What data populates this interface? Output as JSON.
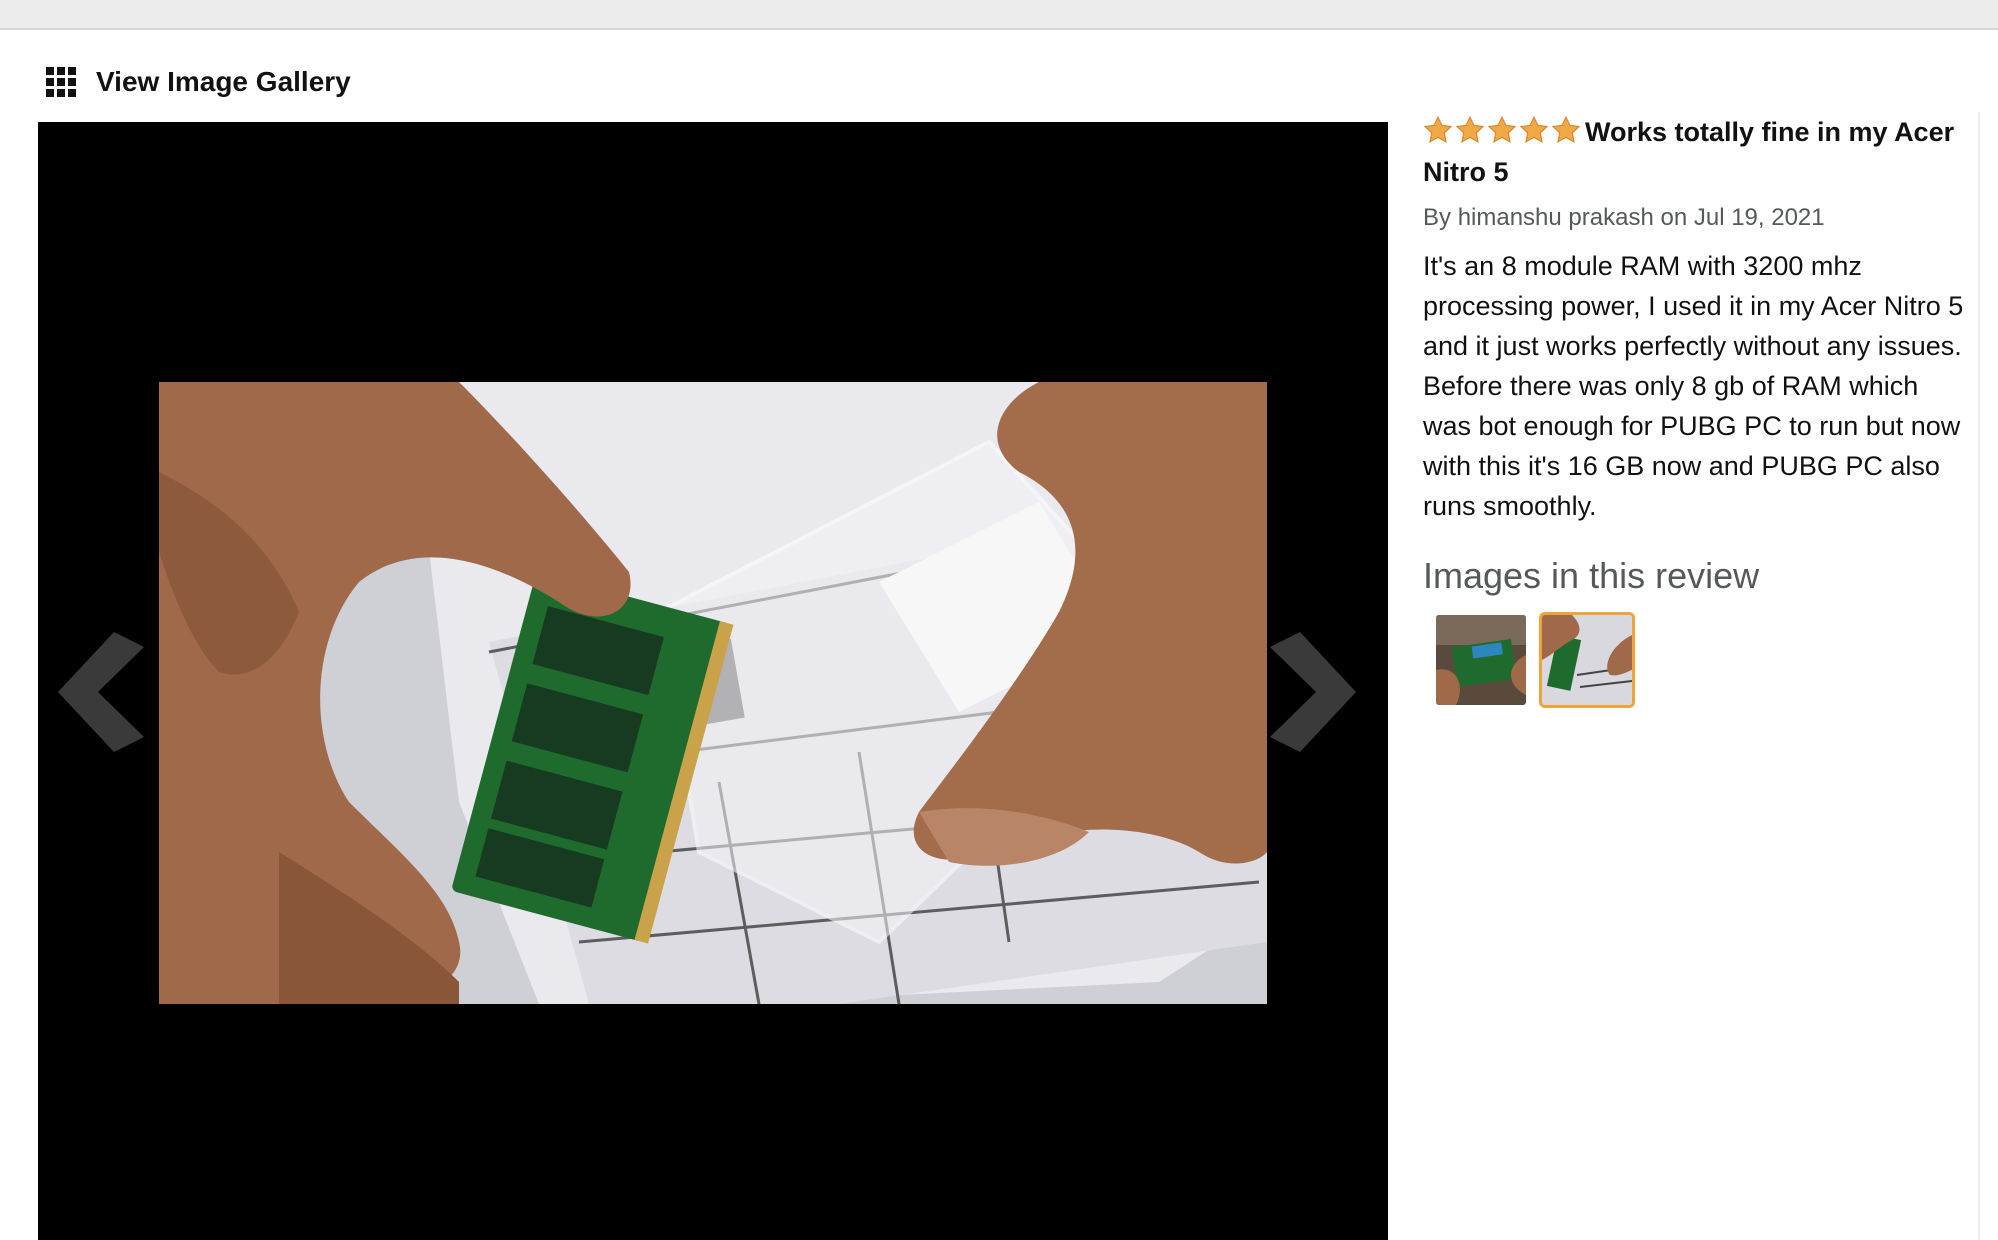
{
  "gallery": {
    "icon": "grid-icon",
    "title": "View Image Gallery"
  },
  "viewer": {
    "prev_icon": "chevron-left-icon",
    "next_icon": "chevron-right-icon"
  },
  "review": {
    "rating": 5,
    "rating_max": 5,
    "star_color": "#f3a847",
    "title": "Works totally fine in my Acer Nitro 5",
    "byline_prefix": "By ",
    "author": "himanshu prakash",
    "date_text": " on Jul 19, 2021",
    "body": "It's an 8 module RAM with 3200 mhz processing power, I used it in my Acer Nitro 5 and it just works perfectly without any issues. Before there was only 8 gb of RAM which was bot enough for PUBG PC to run but now with this it's 16 GB now and PUBG PC also runs smoothly.",
    "images_heading": "Images in this review",
    "thumbnails": [
      {
        "name": "review-image-1",
        "selected": false
      },
      {
        "name": "review-image-2",
        "selected": true
      }
    ]
  },
  "colors": {
    "selected_thumb_border": "#f0a33a",
    "viewer_background": "#000000"
  }
}
